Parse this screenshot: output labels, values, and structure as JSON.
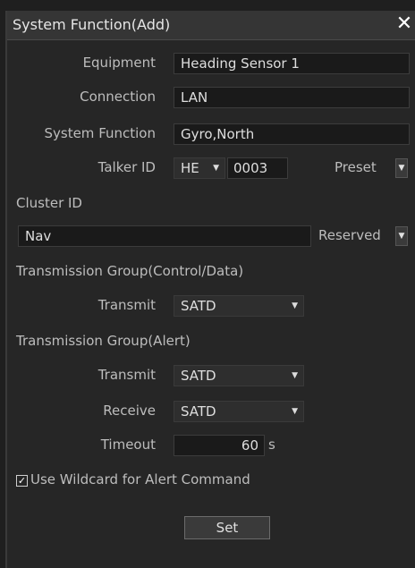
{
  "dialog": {
    "title": "System Function(Add)",
    "close_icon": "close-icon"
  },
  "equipment": {
    "label": "Equipment",
    "value": "Heading Sensor 1"
  },
  "connection": {
    "label": "Connection",
    "value": "LAN"
  },
  "system_function": {
    "label": "System Function",
    "value": "Gyro,North"
  },
  "talker": {
    "label": "Talker ID",
    "prefix": "HE",
    "number": "0003",
    "preset_label": "Preset"
  },
  "cluster": {
    "label": "Cluster ID",
    "value": "Nav",
    "reserved_label": "Reserved"
  },
  "tg_control": {
    "heading": "Transmission Group(Control/Data)",
    "transmit_label": "Transmit",
    "transmit_value": "SATD"
  },
  "tg_alert": {
    "heading": "Transmission Group(Alert)",
    "transmit_label": "Transmit",
    "transmit_value": "SATD",
    "receive_label": "Receive",
    "receive_value": "SATD",
    "timeout_label": "Timeout",
    "timeout_value": "60",
    "timeout_unit": "s"
  },
  "wildcard": {
    "checked": true,
    "label": "Use Wildcard for Alert Command",
    "check_glyph": "✓"
  },
  "set_button": {
    "label": "Set"
  },
  "arrow_glyph": "▼"
}
